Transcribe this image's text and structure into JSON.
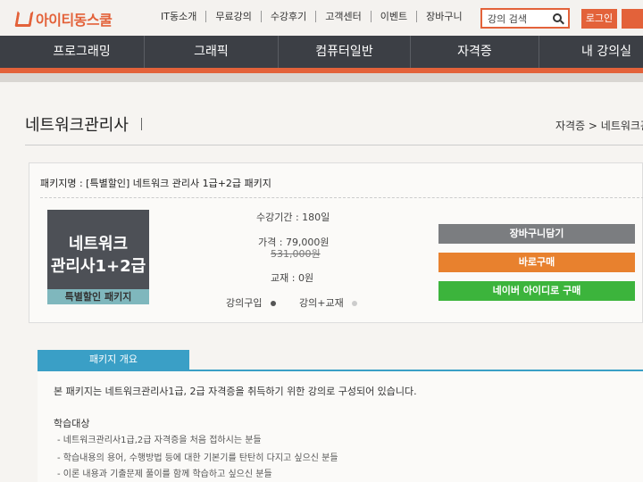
{
  "logo": {
    "text": "아이티동스쿨"
  },
  "topnav": [
    "IT동소개",
    "무료강의",
    "수강후기",
    "고객센터",
    "이벤트",
    "장바구니"
  ],
  "search": {
    "value": "강의 검색"
  },
  "auth": {
    "login": "로그인"
  },
  "mainnav": [
    "프로그래밍",
    "그래픽",
    "컴퓨터일반",
    "자격증",
    "내 강의실"
  ],
  "page": {
    "title": "네트워크관리사",
    "breadcrumb": "자격증 > 네트워크관"
  },
  "package": {
    "name": "패키지명 : [특별할인] 네트워크 관리사 1급+2급 패키지",
    "thumb_line1": "네트워크",
    "thumb_line2": "관리사1+2급",
    "thumb_badge": "특별할인 패키지",
    "period": "수강기간 : 180일",
    "price": "가격 : 79,000원",
    "original_price": "531,000원",
    "textbook": "교재 : 0원",
    "option_course": "강의구입",
    "option_course_text": "강의+교재"
  },
  "buttons": {
    "cart": "장바구니담기",
    "buy": "바로구매",
    "naver": "네이버 아이디로 구매"
  },
  "overview": {
    "tab": "패키지 개요",
    "intro": "본 패키지는 네트워크관리사1급, 2급 자격증을 취득하기 위한 강의로 구성되어 있습니다.",
    "target_title": "학습대상",
    "targets": [
      "- 네트워크관리사1급,2급 자격증을 처음 접하시는 분들",
      "- 학습내용의 용어, 수행방법 등에 대한 기본기를 탄탄히 다지고 싶으신 분들",
      "- 이론 내용과 기출문제 풀이를 함께 학습하고 싶으신 분들"
    ]
  },
  "colors": {
    "accent": "#e3623a",
    "nav": "#3c3f45",
    "tab": "#3a9fc6",
    "buy": "#e8812e",
    "naver": "#3cb43c"
  }
}
